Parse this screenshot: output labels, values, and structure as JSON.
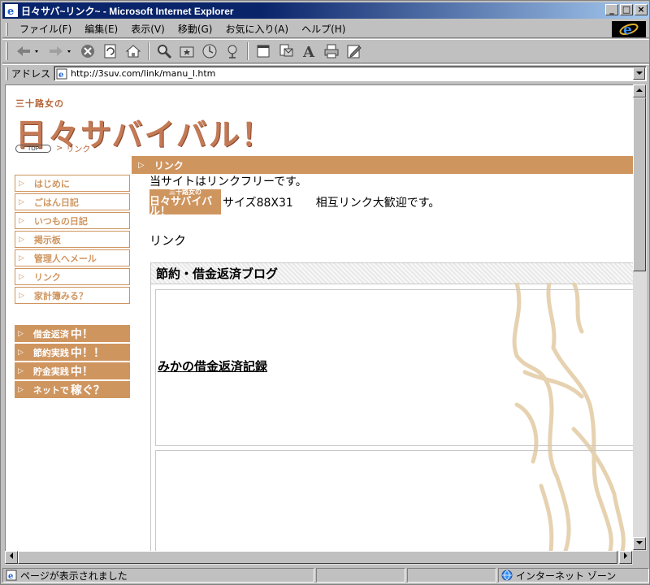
{
  "window": {
    "title": "日々サバ~リンク~ - Microsoft Internet Explorer",
    "controls": {
      "minimize": "_",
      "maximize": "□",
      "close": "×"
    }
  },
  "menu": [
    "ファイル(F)",
    "編集(E)",
    "表示(V)",
    "移動(G)",
    "お気に入り(A)",
    "ヘルプ(H)"
  ],
  "toolbar": {
    "icons": [
      "back-icon",
      "forward-icon",
      "stop-icon",
      "refresh-icon",
      "home-icon",
      "search-icon",
      "favorites-icon",
      "history-icon",
      "channels-icon",
      "fullscreen-icon",
      "mail-icon",
      "font-icon",
      "print-icon",
      "edit-icon"
    ]
  },
  "address": {
    "label": "アドレス",
    "url": "http://3suv.com/link/manu_l.htm"
  },
  "page": {
    "logo_small": "三十路女の",
    "logo_big": "日々サバイバル！",
    "breadcrumb_top": "TOP",
    "breadcrumb_sep": ">",
    "breadcrumb_current": "リンク",
    "section_title": "リンク",
    "nav_main": [
      "はじめに",
      "ごはん日記",
      "いつもの日記",
      "掲示板",
      "管理人へメール",
      "リンク",
      "家計簿みる？"
    ],
    "nav_sub": [
      {
        "label": "借金返済",
        "em": "中！"
      },
      {
        "label": "節約実践",
        "em": "中！！"
      },
      {
        "label": "貯金実践",
        "em": "中！"
      },
      {
        "label": "ネットで",
        "em": "稼ぐ？"
      }
    ],
    "intro": "当サイトはリンクフリーです。",
    "banner_small": "三十路女の",
    "banner_big": "日々サバイバル！",
    "banner_caption": "サイズ88X31　　相互リンク大歓迎です。",
    "link_heading": "リンク",
    "category_title": "節約・借金返済ブログ",
    "link_text": "みかの借金返済記録"
  },
  "status": {
    "message": "ページが表示されました",
    "zone": "インターネット ゾーン"
  }
}
